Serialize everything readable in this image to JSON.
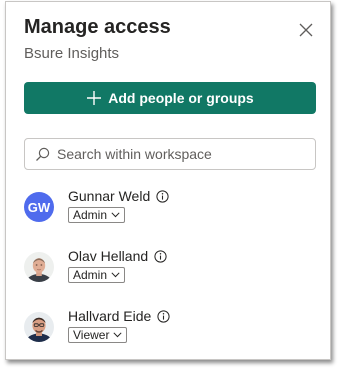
{
  "dialog": {
    "title": "Manage access",
    "workspace_name": "Bsure Insights"
  },
  "actions": {
    "add_label": "Add people or groups"
  },
  "search": {
    "placeholder": "Search within workspace"
  },
  "people": [
    {
      "name": "Gunnar Weld",
      "initials": "GW",
      "role": "Admin",
      "avatar_color": "#4f6bed"
    },
    {
      "name": "Olav Helland",
      "role": "Admin"
    },
    {
      "name": "Hallvard Eide",
      "role": "Viewer"
    }
  ],
  "colors": {
    "primary": "#117865",
    "avatar_initials_bg": "#4f6bed"
  }
}
